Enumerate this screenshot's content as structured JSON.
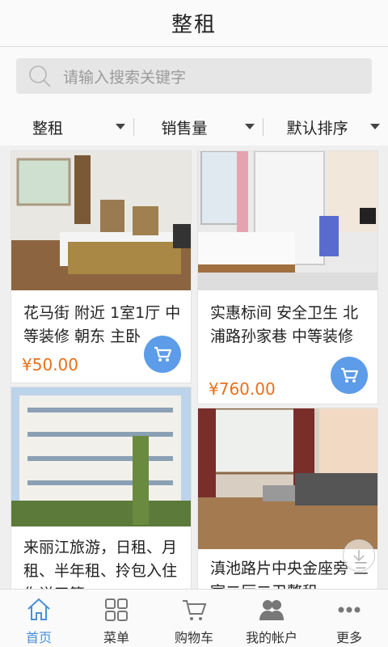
{
  "header": {
    "title": "整租"
  },
  "search": {
    "placeholder": "请输入搜索关键字"
  },
  "filters": [
    {
      "label": "整租"
    },
    {
      "label": "销售量"
    },
    {
      "label": "默认排序"
    }
  ],
  "listings": [
    {
      "name": "花马街 附近 1室1厅 中等装修 朝东 主卧",
      "price": "¥50.00"
    },
    {
      "name": "实惠标间 安全卫生 北浦路孙家巷 中等装修",
      "price": "¥760.00"
    },
    {
      "name": "来丽江旅游，日租、月租、半年租、拎包入住你说了算",
      "price": ""
    },
    {
      "name": "滇池路片中央金座旁 三室二厅二卫整租",
      "price": ""
    }
  ],
  "tabbar": [
    {
      "label": "首页",
      "icon": "home-icon",
      "active": true
    },
    {
      "label": "菜单",
      "icon": "grid-icon"
    },
    {
      "label": "购物车",
      "icon": "cart-icon"
    },
    {
      "label": "我的帐户",
      "icon": "users-icon"
    },
    {
      "label": "更多",
      "icon": "more-icon"
    }
  ],
  "colors": {
    "accent": "#4a8fd8",
    "price": "#e8701a",
    "cart_button": "#5c9ce8"
  }
}
